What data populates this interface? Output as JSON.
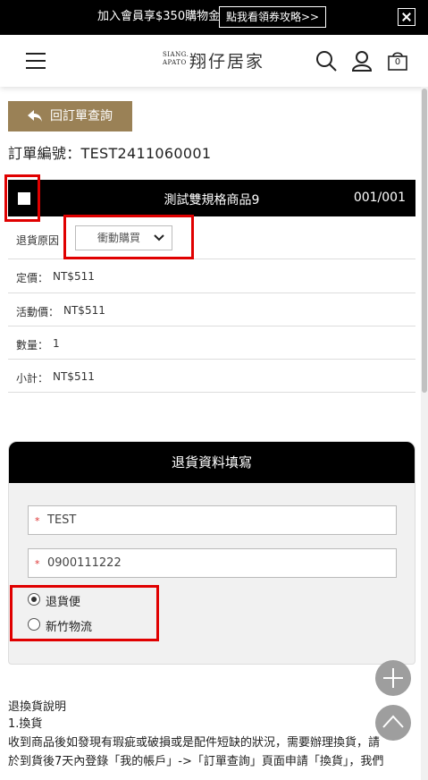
{
  "promo": {
    "text": "加入會員享$350購物金",
    "button_label": "點我看領券攻略>>"
  },
  "header": {
    "logo_en_line1": "SIANG.",
    "logo_en_line2": "APATO",
    "logo_cn": "翔仔居家",
    "cart_count": "0"
  },
  "back_button_label": "回訂單查詢",
  "order": {
    "number_label": "訂單編號：TEST2411060001"
  },
  "product": {
    "name": "測試雙規格商品9",
    "count": "001/001",
    "return_reason_label": "退貨原因",
    "return_reason_value": "衝動購買",
    "rows": [
      {
        "label": "定價：",
        "value": "NT$511"
      },
      {
        "label": "活動價：",
        "value": "NT$511"
      },
      {
        "label": "數量：",
        "value": "1"
      },
      {
        "label": "小計：",
        "value": "NT$511"
      }
    ]
  },
  "return_form": {
    "title": "退貨資料填寫",
    "name_value": "TEST",
    "phone_value": "0900111222",
    "required_mark": "*",
    "shipping_options": [
      {
        "label": "退貨便",
        "checked": true
      },
      {
        "label": "新竹物流",
        "checked": false
      }
    ]
  },
  "explanation": {
    "title": "退換貨說明",
    "item1": "1.換貨",
    "line1": "收到商品後如發現有瑕疵或破損或是配件短缺的狀況，需要辦理換貨，請",
    "line2": "於到貨後7天內登錄「我的帳戶」->「訂單查詢」頁面申請「換貨」，我們"
  },
  "colors": {
    "accent": "#9a8156",
    "highlight": "#e00000",
    "dark": "#000000"
  }
}
